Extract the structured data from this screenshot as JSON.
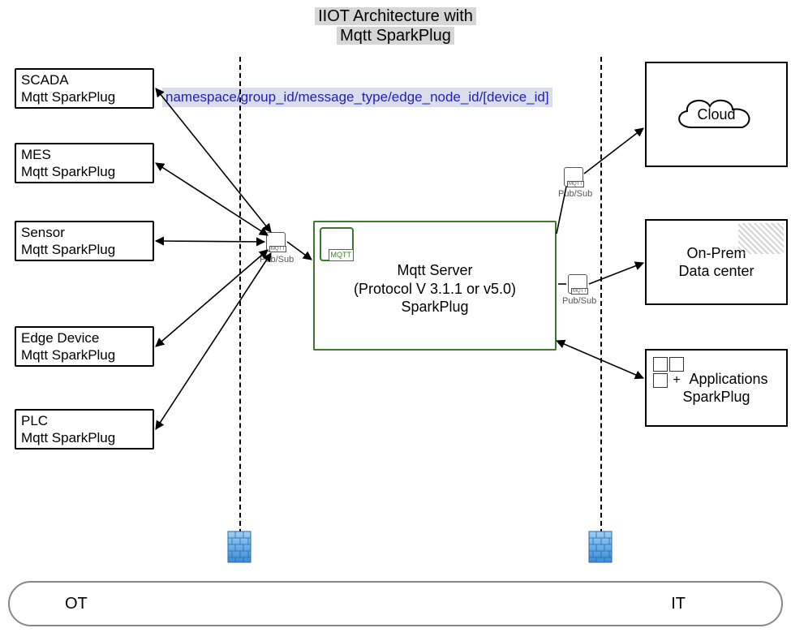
{
  "title": {
    "line1": "IIOT Architecture with",
    "line2": "Mqtt SparkPlug"
  },
  "namespace": "namespace/group_id/message_type/edge_node_id/[device_id]",
  "left_boxes": [
    {
      "id": "scada",
      "line1": "SCADA",
      "line2": "Mqtt SparkPlug"
    },
    {
      "id": "mes",
      "line1": "MES",
      "line2": "Mqtt SparkPlug"
    },
    {
      "id": "sensor",
      "line1": "Sensor",
      "line2": "Mqtt SparkPlug"
    },
    {
      "id": "edge",
      "line1": "Edge Device",
      "line2": "Mqtt SparkPlug"
    },
    {
      "id": "plc",
      "line1": "PLC",
      "line2": "Mqtt SparkPlug"
    }
  ],
  "server": {
    "line1": "Mqtt Server",
    "line2": "(Protocol V 3.1.1 or v5.0)",
    "line3": "SparkPlug",
    "badge_label": "MQTT"
  },
  "pubsub_labels": {
    "left": "Pub/Sub",
    "right_top": "Pub/Sub",
    "right_mid": "Pub/Sub",
    "small_badge_label": "MQTT"
  },
  "right_boxes": {
    "cloud": "Cloud",
    "onprem_line1": "On-Prem",
    "onprem_line2": "Data center",
    "apps_line1": "Applications",
    "apps_line2": "SparkPlug"
  },
  "bottom": {
    "ot": "OT",
    "it": "IT"
  }
}
